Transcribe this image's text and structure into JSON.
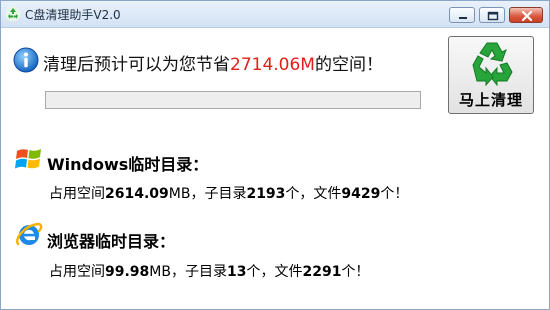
{
  "window": {
    "title": "C盘清理助手V2.0",
    "icons": [
      "recycle-icon",
      "minimize-icon",
      "maximize-icon",
      "close-icon"
    ]
  },
  "summary": {
    "prefix": "清理后预计可以为您节省",
    "amount": "2714.06M",
    "suffix": "的空间！",
    "amount_color": "#e0201a",
    "progress_percent": 0
  },
  "clean_button": {
    "label": "马上清理"
  },
  "sections": [
    {
      "title": "Windows临时目录：",
      "icon": "windows-logo-icon",
      "stats": {
        "l1": "占用空间",
        "size": "2614.09",
        "l2": "MB，子目录",
        "dirs": "2193",
        "l3": "个，文件",
        "files": "9429",
        "l4": "个！"
      }
    },
    {
      "title": "浏览器临时目录：",
      "icon": "ie-browser-icon",
      "stats": {
        "l1": "占用空间",
        "size": "99.98",
        "l2": "MB，子目录",
        "dirs": "13",
        "l3": "个，文件",
        "files": "2291",
        "l4": "个！"
      }
    }
  ]
}
